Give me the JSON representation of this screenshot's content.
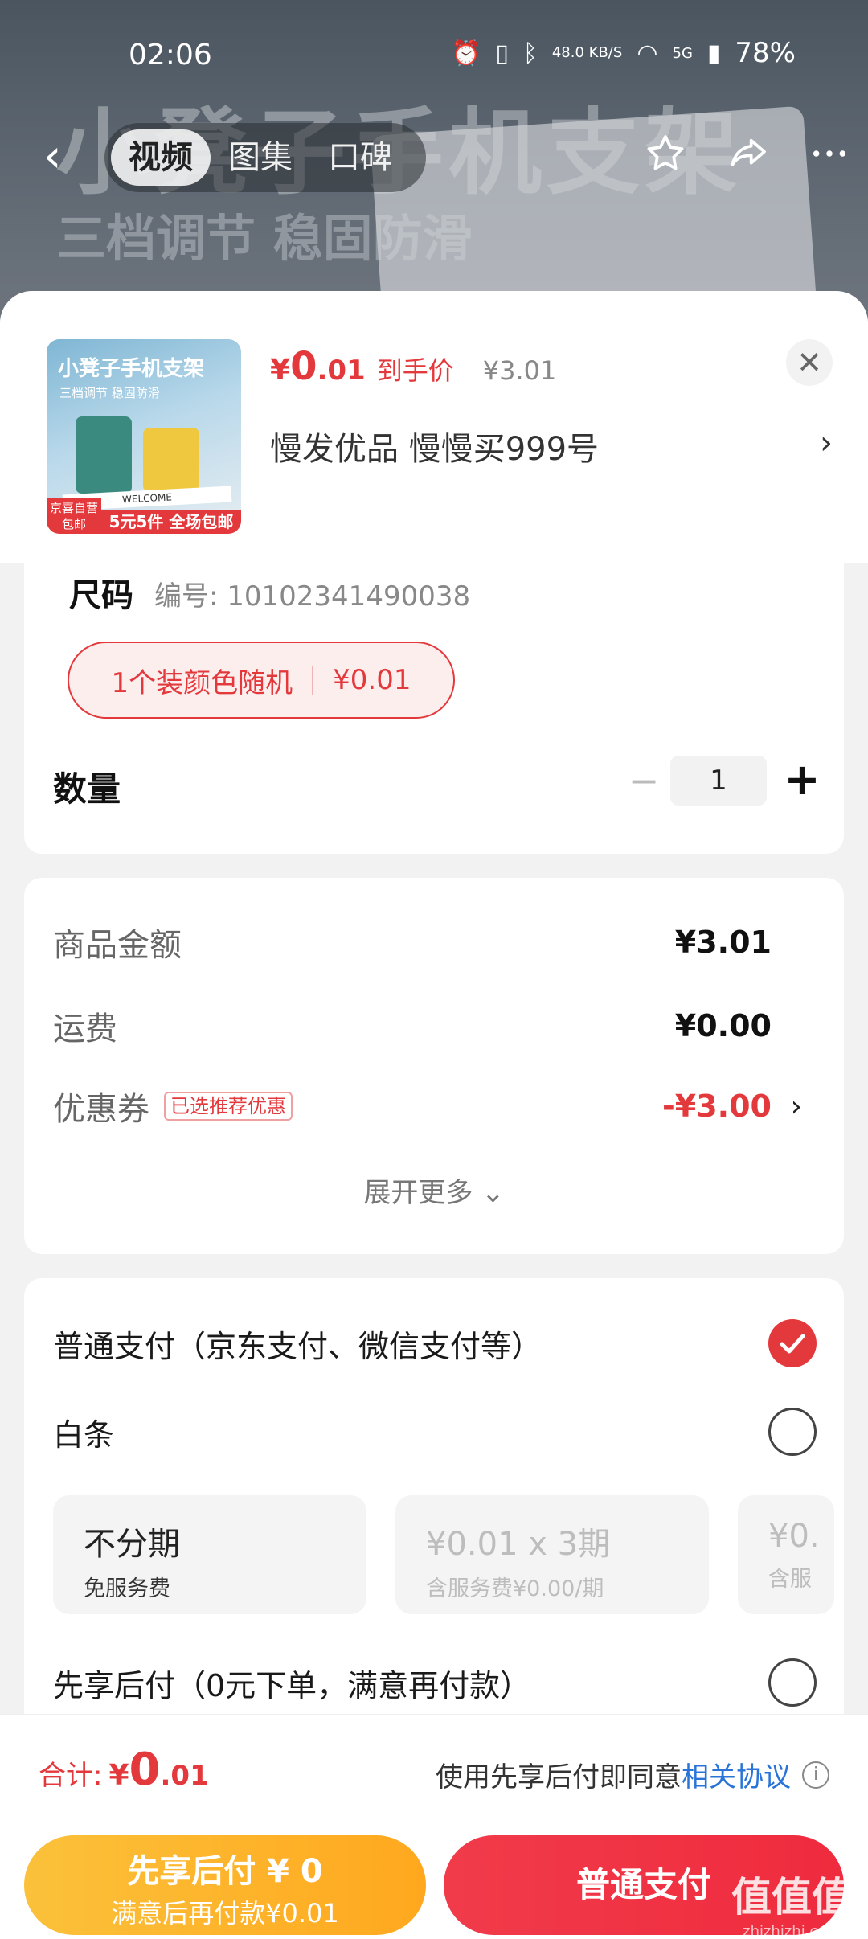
{
  "status_bar": {
    "time": "02:06",
    "net_speed": "48.0 KB/S",
    "network": "5G",
    "battery": "78%"
  },
  "background": {
    "title": "小凳子手机支架",
    "subtitle": "三档调节 稳固防滑"
  },
  "media_tabs": [
    {
      "label": "视频",
      "active": true
    },
    {
      "label": "图集",
      "active": false
    },
    {
      "label": "口碑",
      "active": false
    }
  ],
  "product": {
    "thumb_title": "小凳子手机支架",
    "thumb_subtitle": "三档调节 稳固防滑",
    "thumb_book": "WELCOME",
    "thumb_badge_left": "京喜自营 包邮",
    "thumb_badge_right": "5元5件 全场包邮",
    "price_symbol": "¥",
    "price_int": "0",
    "price_dec": ".01",
    "price_tag": "到手价",
    "original_price": "¥3.01",
    "shop_line": "慢发优品  慢慢买999号",
    "close_icon": "close-icon"
  },
  "spec": {
    "label": "尺码",
    "code": "编号: 10102341490038",
    "option_name": "1个装颜色随机",
    "option_price": "¥0.01"
  },
  "quantity": {
    "label": "数量",
    "value": "1",
    "minus": "−",
    "plus": "+"
  },
  "costs": [
    {
      "label": "商品金额",
      "value": "¥3.01"
    },
    {
      "label": "运费",
      "value": "¥0.00"
    },
    {
      "label": "优惠券",
      "tag": "已选推荐优惠",
      "value": "-¥3.00"
    }
  ],
  "expand_more": "展开更多",
  "payment": {
    "options": [
      {
        "label": "普通支付（京东支付、微信支付等）",
        "checked": true
      },
      {
        "label": "白条",
        "checked": false
      },
      {
        "label": "先享后付（0元下单，满意再付款）",
        "checked": false
      }
    ],
    "plans": [
      {
        "title": "不分期",
        "sub": "免服务费",
        "disabled": false
      },
      {
        "title": "¥0.01 x 3期",
        "sub": "含服务费¥0.00/期",
        "disabled": true
      },
      {
        "title": "¥0.",
        "sub": "含服",
        "disabled": true
      }
    ]
  },
  "bottom": {
    "total_label": "合计:",
    "total_symbol": "¥",
    "total_int": "0",
    "total_dec": ".01",
    "agree_text": "使用先享后付即同意",
    "agree_link": "相关协议",
    "btn_later_line1": "先享后付 ¥ 0",
    "btn_later_line2": "满意后再付款¥0.01",
    "btn_normal": "普通支付"
  },
  "watermark": {
    "text": "值值值",
    "domain": "zhizhizhi.com"
  },
  "colors": {
    "accent": "#e4393c",
    "link": "#2a74d8",
    "yellow_button": "#fbc13a"
  }
}
